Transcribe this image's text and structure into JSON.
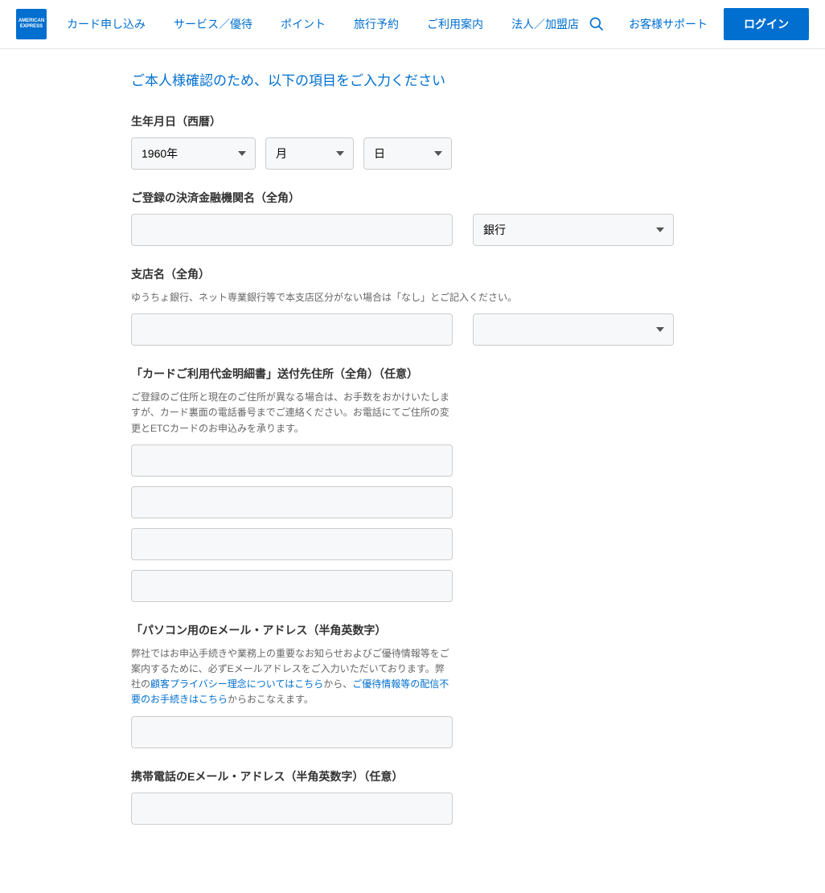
{
  "header": {
    "logo_text": "AMERICAN EXPRESS",
    "nav": [
      "カード申し込み",
      "サービス／優待",
      "ポイント",
      "旅行予約",
      "ご利用案内",
      "法人／加盟店"
    ],
    "support": "お客様サポート",
    "login": "ログイン"
  },
  "page": {
    "heading": "ご本人様確認のため、以下の項目をご入力ください"
  },
  "fields": {
    "dob": {
      "label": "生年月日（西暦）",
      "year": "1960年",
      "month": "月",
      "day": "日"
    },
    "bank": {
      "label": "ご登録の決済金融機関名（全角）",
      "type_selected": "銀行"
    },
    "branch": {
      "label": "支店名（全角）",
      "hint": "ゆうちょ銀行、ネット専業銀行等で本支店区分がない場合は「なし」とご記入ください。"
    },
    "address": {
      "label": "「カードご利用代金明細書」送付先住所（全角）（任意）",
      "hint": "ご登録のご住所と現在のご住所が異なる場合は、お手数をおかけいたしますが、カード裏面の電話番号までご連絡ください。お電話にてご住所の変更とETCカードのお申込みを承ります。"
    },
    "pc_email": {
      "label": "「パソコン用のEメール・アドレス（半角英数字）",
      "hint_prefix": "弊社ではお申込手続きや業務上の重要なお知らせおよびご優待情報等をご案内するために、必ずEメールアドレスをご入力いただいております。弊社の",
      "hint_link1": "顧客プライバシー理念についてはこちら",
      "hint_mid": "から、",
      "hint_link2": "ご優待情報等の配信不要のお手続きはこちら",
      "hint_suffix": "からおこなえます。"
    },
    "mobile_email": {
      "label": "携帯電話のEメール・アドレス（半角英数字）（任意）"
    }
  }
}
